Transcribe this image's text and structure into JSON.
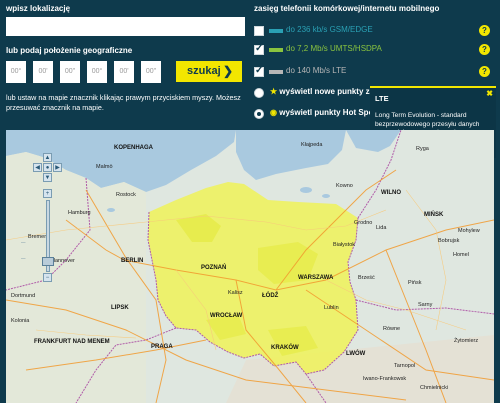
{
  "left": {
    "location_label": "wpisz lokalizację",
    "search_value": "",
    "geo_label": "lub podaj położenie geograficzne",
    "coords": [
      "00°",
      "00'",
      "00\"",
      "00°",
      "00'",
      "00\""
    ],
    "search_button": "szukaj",
    "help_text": "lub ustaw na mapie znacznik klikając prawym przyciskiem myszy. Możesz przesuwać znacznik na mapie."
  },
  "right": {
    "title": "zasięg telefonii komórkowej/internetu mobilnego",
    "networks": [
      {
        "text": "do 236 kb/s GSM/EDGE",
        "color": "#2aa0b4",
        "checked": false
      },
      {
        "text": "do 7,2 Mb/s UMTS/HSDPA",
        "color": "#8ac43f",
        "checked": true
      },
      {
        "text": "do 140 Mb/s LTE",
        "color": "#b6b6b6",
        "checked": true
      }
    ],
    "show_points": "wyświetl nowe punkty zas",
    "show_hotspots": "wyświetl punkty Hot Spot"
  },
  "tooltip": {
    "title": "LTE",
    "body": "Long Term Evolution - standard bezprzewodowego przesyłu danych zapewniający znacznie szybszy transferdanych."
  },
  "map": {
    "cities": [
      {
        "name": "KOPENHAGA",
        "big": true
      },
      {
        "name": "Kłajpeda",
        "big": false
      },
      {
        "name": "Kowno",
        "big": false
      },
      {
        "name": "WILNO",
        "big": true
      },
      {
        "name": "MIŃSK",
        "big": true
      },
      {
        "name": "BERLIN",
        "big": true
      },
      {
        "name": "Hamburg",
        "big": false
      },
      {
        "name": "Rostock",
        "big": false
      },
      {
        "name": "Bremen",
        "big": false
      },
      {
        "name": "Hannover",
        "big": false
      },
      {
        "name": "LIPSK",
        "big": true
      },
      {
        "name": "Dortmund",
        "big": false
      },
      {
        "name": "Kolonia",
        "big": false
      },
      {
        "name": "FRANKFURT NAD MENEM",
        "big": true
      },
      {
        "name": "PRAGA",
        "big": true
      },
      {
        "name": "WROCŁAW",
        "big": true
      },
      {
        "name": "POZNAŃ",
        "big": true
      },
      {
        "name": "WARSZAWA",
        "big": true
      },
      {
        "name": "ŁÓDŹ",
        "big": true
      },
      {
        "name": "KRAKÓW",
        "big": true
      },
      {
        "name": "Brześć",
        "big": false
      },
      {
        "name": "Homel",
        "big": false
      },
      {
        "name": "Pińsk",
        "big": false
      },
      {
        "name": "Równe",
        "big": false
      },
      {
        "name": "Żytomierz",
        "big": false
      },
      {
        "name": "LWÓW",
        "big": true
      },
      {
        "name": "Iwano-Frankowsk",
        "big": false
      },
      {
        "name": "Tarnopol",
        "big": false
      },
      {
        "name": "Chmielnicki",
        "big": false
      },
      {
        "name": "Lida",
        "big": false
      },
      {
        "name": "Grodno",
        "big": false
      },
      {
        "name": "Białystok",
        "big": false
      },
      {
        "name": "Lublin",
        "big": false
      },
      {
        "name": "Mohylew",
        "big": false
      },
      {
        "name": "Bobrujsk",
        "big": false
      },
      {
        "name": "Sarny",
        "big": false
      },
      {
        "name": "Kalisz",
        "big": false
      },
      {
        "name": "Malmö",
        "big": false
      },
      {
        "name": "Ryga",
        "big": false
      }
    ]
  }
}
